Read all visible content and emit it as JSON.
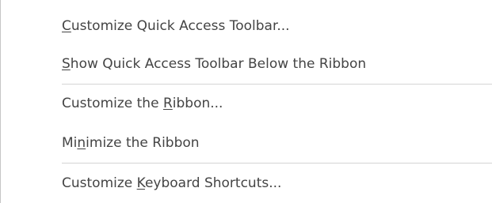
{
  "menu": {
    "items": [
      {
        "pre": "",
        "key": "C",
        "post": "ustomize Quick Access Toolbar..."
      },
      {
        "pre": "",
        "key": "S",
        "post": "how Quick Access Toolbar Below the Ribbon"
      },
      {
        "pre": "Customize the ",
        "key": "R",
        "post": "ibbon..."
      },
      {
        "pre": "Mi",
        "key": "n",
        "post": "imize the Ribbon"
      },
      {
        "pre": "Customize ",
        "key": "K",
        "post": "eyboard Shortcuts..."
      }
    ]
  }
}
